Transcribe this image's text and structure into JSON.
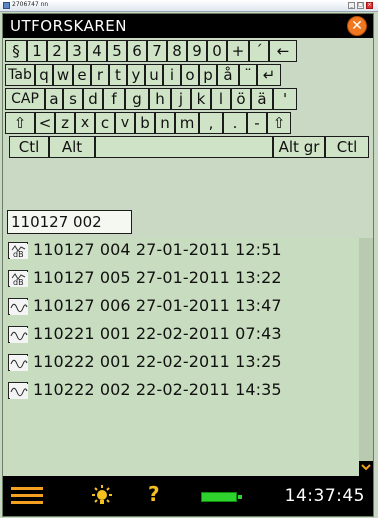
{
  "window": {
    "title": "2706747 nn",
    "controls": [
      "_",
      "□",
      "×"
    ]
  },
  "app": {
    "title": "UTFORSKAREN"
  },
  "keyboard": {
    "row1": [
      "§",
      "1",
      "2",
      "3",
      "4",
      "5",
      "6",
      "7",
      "8",
      "9",
      "0",
      "+",
      "´",
      "←"
    ],
    "row2": [
      "Tab",
      "q",
      "w",
      "e",
      "r",
      "t",
      "y",
      "u",
      "i",
      "o",
      "p",
      "å",
      "¨",
      "↵"
    ],
    "row3": [
      "CAP",
      "a",
      "s",
      "d",
      "f",
      "g",
      "h",
      "j",
      "k",
      "l",
      "ö",
      "ä",
      "'"
    ],
    "row4": [
      "⇧",
      "<",
      "z",
      "x",
      "c",
      "v",
      "b",
      "n",
      "m",
      ",",
      ".",
      "-",
      "⇧"
    ],
    "row5": [
      "Ctl",
      "Alt",
      "",
      "Alt gr",
      "Ctl"
    ]
  },
  "search": {
    "value": "110127 002"
  },
  "files": [
    {
      "icon": "audio-data-icon",
      "name": "110127 004",
      "date": "27-01-2011",
      "time": "12:51"
    },
    {
      "icon": "audio-data-icon",
      "name": "110127 005",
      "date": "27-01-2011",
      "time": "13:22"
    },
    {
      "icon": "waveform-icon",
      "name": "110127 006",
      "date": "27-01-2011",
      "time": "13:47"
    },
    {
      "icon": "waveform-icon",
      "name": "110221 001",
      "date": "22-02-2011",
      "time": "07:43"
    },
    {
      "icon": "waveform-icon",
      "name": "110222 001",
      "date": "22-02-2011",
      "time": "13:25"
    },
    {
      "icon": "waveform-icon",
      "name": "110222 002",
      "date": "22-02-2011",
      "time": "14:35"
    }
  ],
  "status": {
    "clock": "14:37:45",
    "battery_level": 1.0
  },
  "colors": {
    "accent": "#f4a020",
    "header": "#000000",
    "list_bg": "#c8ddc0",
    "battery": "#2ed32e"
  }
}
